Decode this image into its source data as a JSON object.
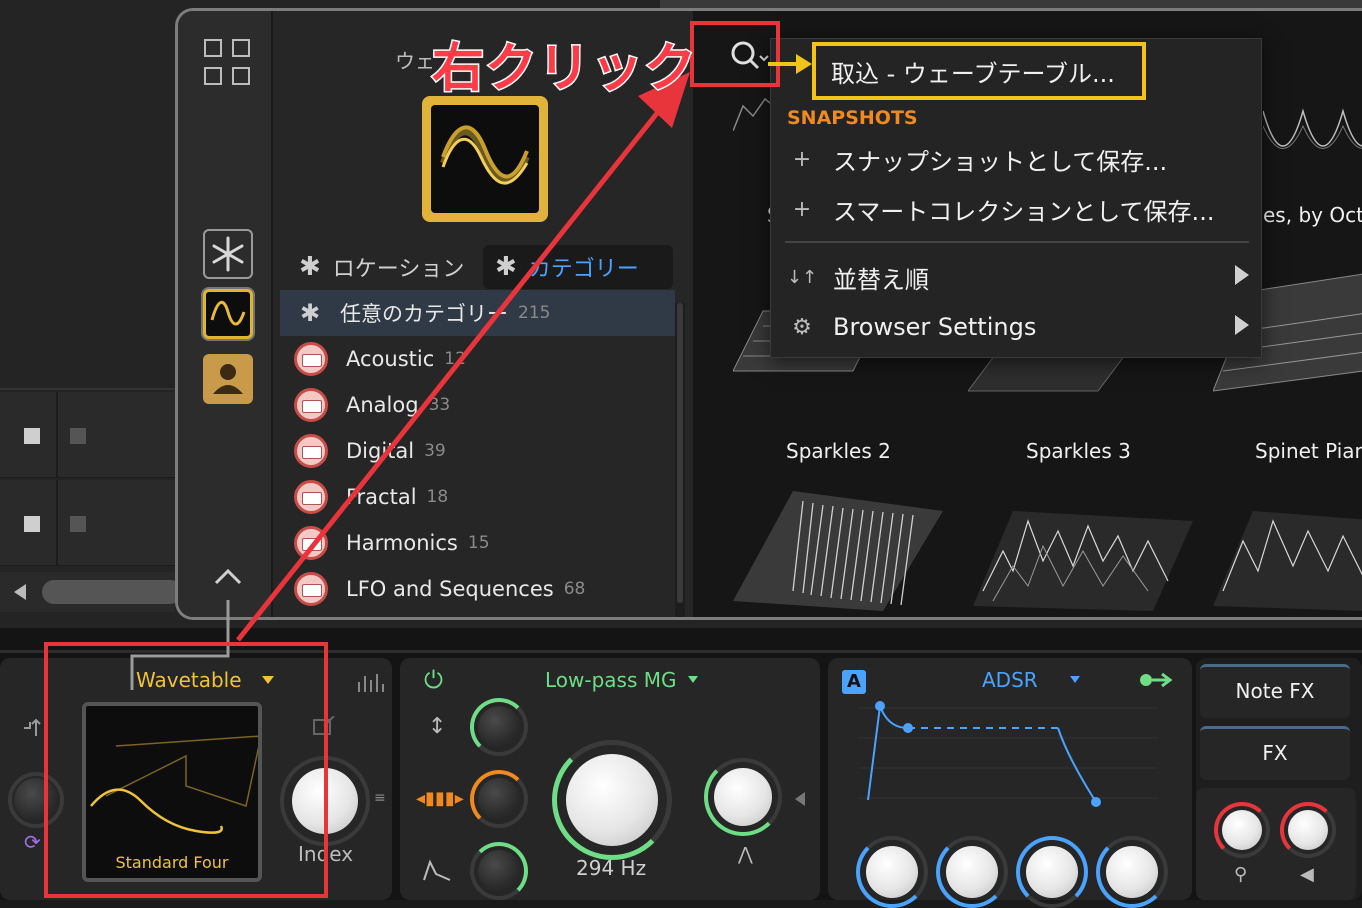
{
  "annotation": {
    "label": "右クリック",
    "color": "#e8343b",
    "highlight_color": "#f2c418"
  },
  "browser": {
    "header_partial": "ウェ",
    "tabs": {
      "location": "ロケーション",
      "category": "カテゴリー"
    },
    "tab_icon": "asterisk-icon",
    "categories": [
      {
        "label": "任意のカテゴリー",
        "count": "215"
      },
      {
        "label": "Acoustic",
        "count": "12"
      },
      {
        "label": "Analog",
        "count": "33"
      },
      {
        "label": "Digital",
        "count": "39"
      },
      {
        "label": "Fractal",
        "count": "18"
      },
      {
        "label": "Harmonics",
        "count": "15"
      },
      {
        "label": "LFO and Sequences",
        "count": "68"
      }
    ],
    "presets": {
      "partial_title": "es, by Octa",
      "partial_s": "S",
      "row2": [
        "Sparkles 2",
        "Sparkles 3",
        "Spinet Pian"
      ]
    }
  },
  "context_menu": {
    "import": "取込 - ウェーブテーブル...",
    "section": "SNAPSHOTS",
    "section_color": "#f08a1e",
    "save_snapshot": "スナップショットとして保存...",
    "save_smart": "スマートコレクションとして保存...",
    "sort": "並替え順",
    "settings": "Browser Settings"
  },
  "device": {
    "osc": {
      "type": "Wavetable",
      "preset": "Standard Four",
      "index_label": "Index"
    },
    "filter": {
      "name": "Low-pass MG",
      "freq": "294 Hz",
      "color": "#6fdc86"
    },
    "env": {
      "badge": "A",
      "name": "ADSR",
      "color": "#4aa3ff"
    },
    "fx": {
      "note_fx": "Note FX",
      "fx": "FX"
    }
  }
}
